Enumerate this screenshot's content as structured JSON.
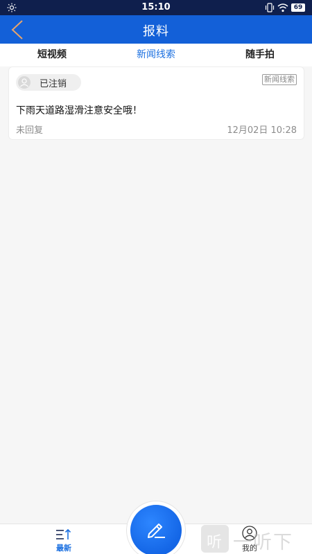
{
  "status_bar": {
    "time": "15:10",
    "battery": "69"
  },
  "header": {
    "title": "报料"
  },
  "tabs": [
    {
      "label": "短视频",
      "active": false
    },
    {
      "label": "新闻线索",
      "active": true
    },
    {
      "label": "随手拍",
      "active": false
    }
  ],
  "posts": [
    {
      "user": "已注销",
      "tag": "新闻线索",
      "content": "下雨天道路湿滑注意安全哦！",
      "reply_status": "未回复",
      "date": "12月02日 10:28"
    }
  ],
  "bottom_nav": {
    "latest_label": "最新",
    "me_label": "我的"
  },
  "watermark": {
    "logo_char": "听",
    "text": "一听下载"
  },
  "colors": {
    "brand": "#1360d8",
    "active_tab": "#1a6fe0",
    "status_bar": "#0f1f4d"
  }
}
